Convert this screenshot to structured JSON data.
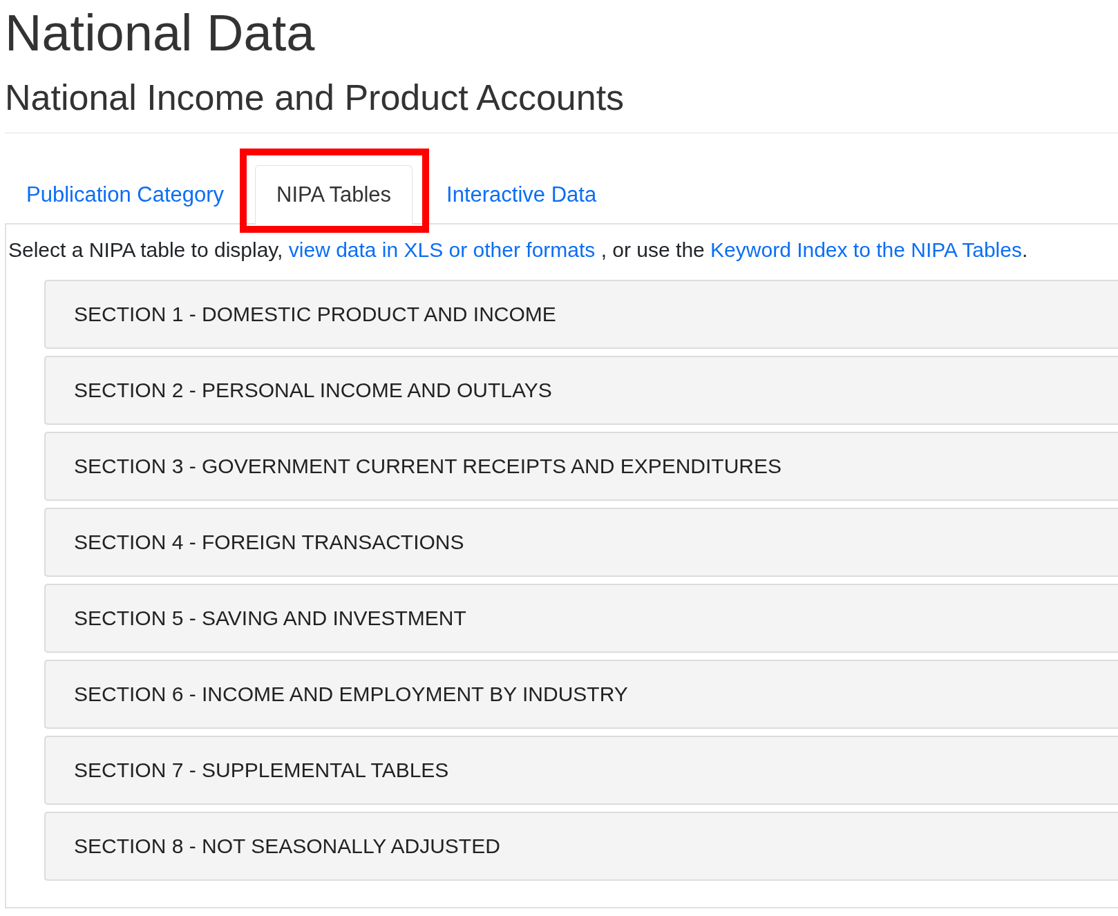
{
  "heading": "National Data",
  "subheading": "National Income and Product Accounts",
  "tabs": [
    {
      "label": "Publication Category",
      "selected": false,
      "highlighted": false
    },
    {
      "label": "NIPA Tables",
      "selected": true,
      "highlighted": true
    },
    {
      "label": "Interactive Data",
      "selected": false,
      "highlighted": false
    }
  ],
  "intro": [
    {
      "kind": "text",
      "text": "Select a NIPA table to display, "
    },
    {
      "kind": "link",
      "text": "view data in XLS or other formats"
    },
    {
      "kind": "text",
      "text": " , or use the "
    },
    {
      "kind": "link",
      "text": "Keyword Index to the NIPA Tables"
    },
    {
      "kind": "text",
      "text": "."
    }
  ],
  "sections": [
    "SECTION 1 - DOMESTIC PRODUCT AND INCOME",
    "SECTION 2 - PERSONAL INCOME AND OUTLAYS",
    "SECTION 3 - GOVERNMENT CURRENT RECEIPTS AND EXPENDITURES",
    "SECTION 4 - FOREIGN TRANSACTIONS",
    "SECTION 5 - SAVING AND INVESTMENT",
    "SECTION 6 - INCOME AND EMPLOYMENT BY INDUSTRY",
    "SECTION 7 - SUPPLEMENTAL TABLES",
    "SECTION 8 - NOT SEASONALLY ADJUSTED"
  ]
}
